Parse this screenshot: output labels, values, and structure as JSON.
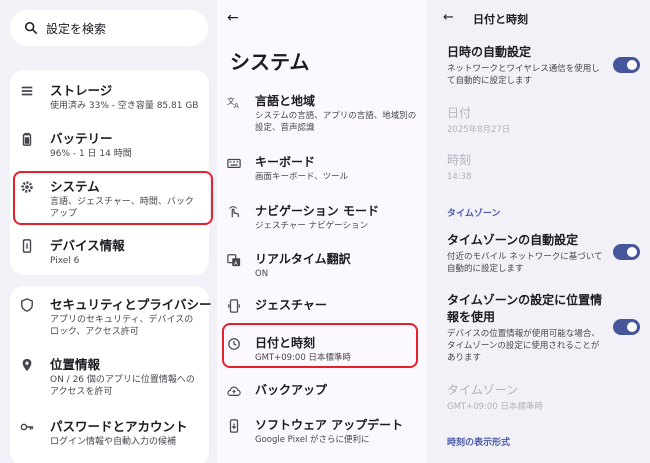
{
  "search": {
    "placeholder": "設定を検索"
  },
  "left_items": [
    {
      "title": "ストレージ",
      "subtitle": "使用済み 33% - 空き容量 85.81 GB",
      "icon": "list-icon"
    },
    {
      "title": "バッテリー",
      "subtitle": "96% - 1 日 14 時間",
      "icon": "battery-icon"
    },
    {
      "title": "システム",
      "subtitle": "言語、ジェスチャー、時間、バックアップ",
      "icon": "gear-icon"
    },
    {
      "title": "デバイス情報",
      "subtitle": "Pixel 6",
      "icon": "phone-info-icon"
    },
    {
      "title": "セキュリティとプライバシー",
      "subtitle": "アプリのセキュリティ、デバイスのロック、アクセス許可",
      "icon": "shield-icon"
    },
    {
      "title": "位置情報",
      "subtitle": "ON / 26 個のアプリに位置情報へのアクセスを許可",
      "icon": "location-pin-icon"
    },
    {
      "title": "パスワードとアカウント",
      "subtitle": "ログイン情報や自動入力の候補",
      "icon": "key-icon"
    }
  ],
  "middle": {
    "back": "←",
    "title": "システム",
    "items": [
      {
        "title": "言語と地域",
        "subtitle": "システムの言語、アプリの言語、地域別の設定、音声認識",
        "icon": "translate-icon"
      },
      {
        "title": "キーボード",
        "subtitle": "画面キーボード、ツール",
        "icon": "keyboard-icon"
      },
      {
        "title": "ナビゲーション モード",
        "subtitle": "ジェスチャー ナビゲーション",
        "icon": "gesture-hand-icon"
      },
      {
        "title": "リアルタイム翻訳",
        "subtitle": "ON",
        "icon": "live-translate-icon"
      },
      {
        "title": "ジェスチャー",
        "subtitle": "",
        "icon": "phone-gesture-icon"
      },
      {
        "title": "日付と時刻",
        "subtitle": "GMT+09:00 日本標準時",
        "icon": "clock-icon"
      },
      {
        "title": "バックアップ",
        "subtitle": "",
        "icon": "cloud-icon"
      },
      {
        "title": "ソフトウェア アップデート",
        "subtitle": "Google Pixel がさらに便利に",
        "icon": "system-update-icon"
      }
    ]
  },
  "right": {
    "back": "←",
    "title": "日付と時刻",
    "auto_datetime": {
      "title": "日時の自動設定",
      "subtitle": "ネットワークとワイヤレス通信を使用して自動的に設定します",
      "on": true
    },
    "date": {
      "title": "日付",
      "subtitle": "2025年8月27日"
    },
    "time": {
      "title": "時刻",
      "subtitle": "14:38"
    },
    "timezone_section": "タイムゾーン",
    "auto_timezone": {
      "title": "タイムゾーンの自動設定",
      "subtitle": "付近のモバイル ネットワークに基づいて自動的に設定します",
      "on": true
    },
    "location_timezone": {
      "title": "タイムゾーンの設定に位置情報を使用",
      "subtitle": "デバイスの位置情報が使用可能な場合、タイムゾーンの設定に使用されることがあります",
      "on": true
    },
    "timezone": {
      "title": "タイムゾーン",
      "subtitle": "GMT+09:00 日本標準時"
    },
    "format_section": "時刻の表示形式"
  },
  "colors": {
    "accent": "#46569b",
    "highlight": "#e5202b",
    "section": "#4a5ba8"
  }
}
